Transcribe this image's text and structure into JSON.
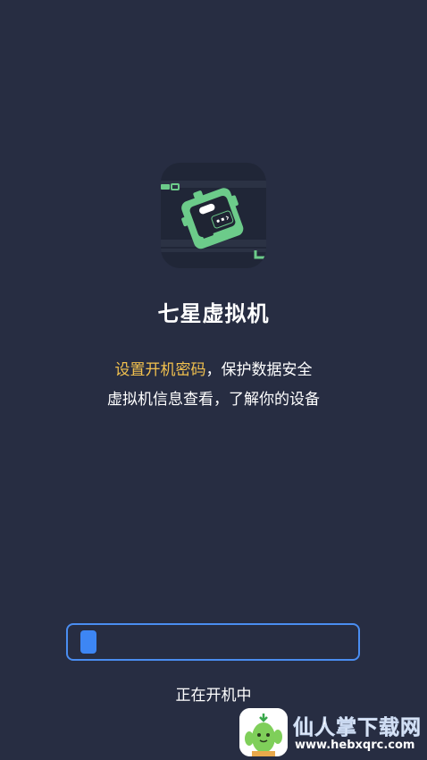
{
  "app": {
    "name": "七星虚拟机"
  },
  "description": {
    "line1_highlight": "设置开机密码",
    "line1_rest": "，保护数据安全",
    "line2": "虚拟机信息查看，了解你的设备"
  },
  "boot": {
    "status": "正在开机中",
    "progress": 0.06
  },
  "watermark": {
    "name": "仙人掌下载网",
    "url": "www.hebxqrc.com"
  },
  "colors": {
    "background": "#272d42",
    "highlight": "#f2c14e",
    "progress_accent": "#3d86f4",
    "icon_green": "#6ccb8a"
  }
}
